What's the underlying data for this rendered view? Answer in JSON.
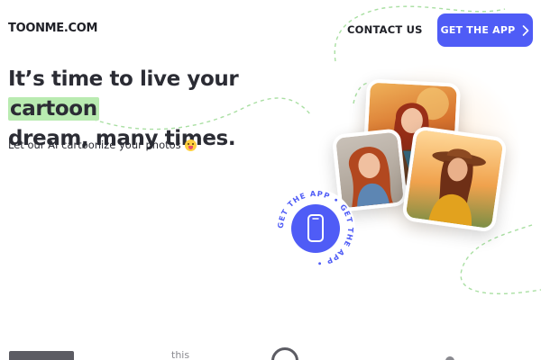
{
  "header": {
    "logo_text": "TOONME.COM",
    "nav_contact_label": "CONTACT US",
    "cta_label": "GET THE APP"
  },
  "hero": {
    "headline_part1": "It’s time to live your ",
    "headline_highlight": "cartoon",
    "headline_part2": "dream, many times.",
    "subline": "Let our AI cartoonize your photos",
    "subline_emoji": "face-with-tongue-icon"
  },
  "badge": {
    "ring_text": "GET THE APP • GET THE APP • ",
    "icon": "smartphone-icon"
  },
  "partners": {
    "partner_2_text": "this"
  },
  "colors": {
    "accent": "#4f5cf6",
    "highlight": "#b9ebb1",
    "text": "#2b2c34",
    "dashed_lines": "#a9dfa2"
  }
}
